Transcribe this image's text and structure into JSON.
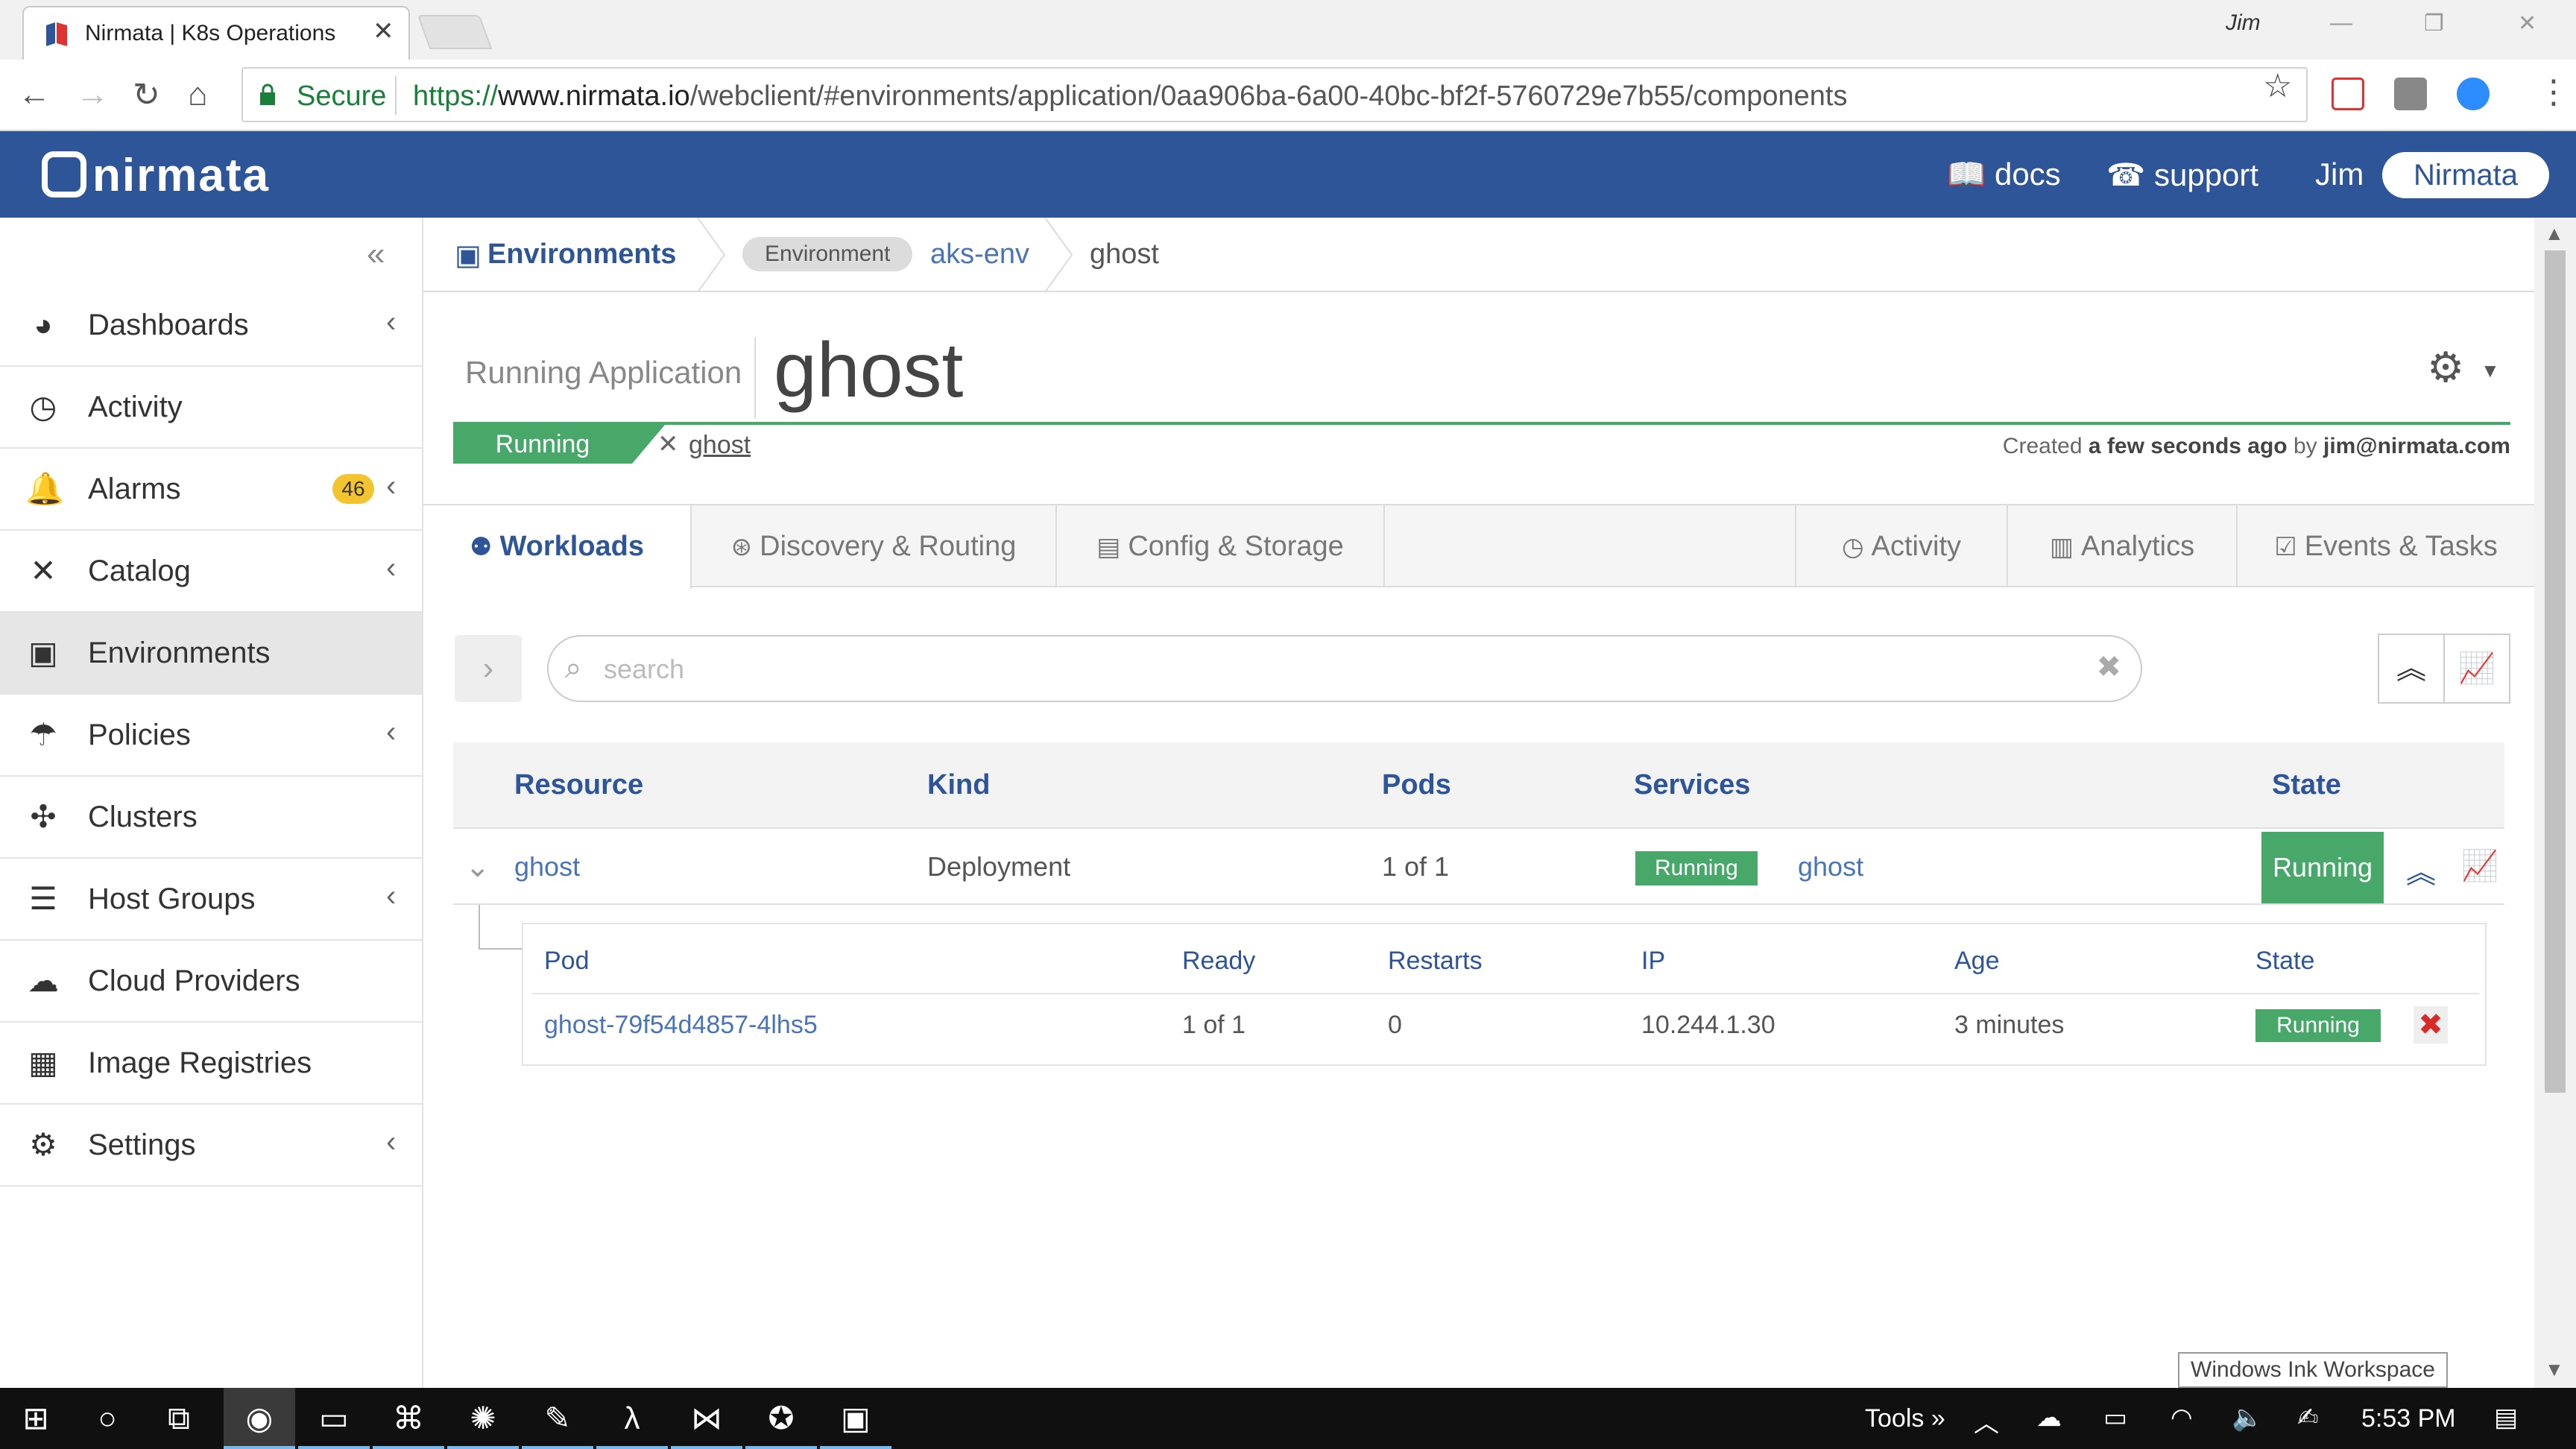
{
  "browser": {
    "tab_title": "Nirmata | K8s Operations",
    "profile_name": "Jim",
    "secure_label": "Secure",
    "url_protocol": "https://",
    "url_host": "www.nirmata.io",
    "url_path": "/webclient/#environments/application/0aa906ba-6a00-40bc-bf2f-5760729e7b55/components"
  },
  "header": {
    "logo": "nirmata",
    "docs_label": "docs",
    "support_label": "support",
    "user": "Jim",
    "org": "Nirmata",
    "brand_color": "#2d5597"
  },
  "sidebar": {
    "items": [
      {
        "label": "Dashboards",
        "icon": "dashboard-icon",
        "chevron": true
      },
      {
        "label": "Activity",
        "icon": "clock-icon",
        "chevron": false
      },
      {
        "label": "Alarms",
        "icon": "bell-icon",
        "chevron": true,
        "badge": "46"
      },
      {
        "label": "Catalog",
        "icon": "tools-icon",
        "chevron": true
      },
      {
        "label": "Environments",
        "icon": "monitor-icon",
        "chevron": false,
        "active": true
      },
      {
        "label": "Policies",
        "icon": "umbrella-icon",
        "chevron": true
      },
      {
        "label": "Clusters",
        "icon": "cluster-icon",
        "chevron": false
      },
      {
        "label": "Host Groups",
        "icon": "server-icon",
        "chevron": true
      },
      {
        "label": "Cloud Providers",
        "icon": "cloud-icon",
        "chevron": false
      },
      {
        "label": "Image Registries",
        "icon": "grid-icon",
        "chevron": false
      },
      {
        "label": "Settings",
        "icon": "gears-icon",
        "chevron": true
      }
    ]
  },
  "breadcrumb": {
    "root": "Environments",
    "type_pill": "Environment",
    "environment": "aks-env",
    "current": "ghost"
  },
  "app": {
    "subtitle": "Running Application",
    "title": "ghost",
    "status": "Running",
    "catalog_link": "ghost",
    "created_prefix": "Created",
    "created_when": "a few seconds ago",
    "created_by_prefix": "by",
    "created_by": "jim@nirmata.com"
  },
  "tabs": {
    "workloads": "Workloads",
    "discovery": "Discovery & Routing",
    "config": "Config & Storage",
    "activity": "Activity",
    "analytics": "Analytics",
    "events": "Events & Tasks"
  },
  "search": {
    "placeholder": "search",
    "value": ""
  },
  "workloads_table": {
    "headers": {
      "resource": "Resource",
      "kind": "Kind",
      "pods": "Pods",
      "services": "Services",
      "state": "State"
    },
    "rows": [
      {
        "resource": "ghost",
        "kind": "Deployment",
        "pods": "1 of 1",
        "service_status": "Running",
        "service_name": "ghost",
        "state": "Running"
      }
    ]
  },
  "pods_table": {
    "headers": {
      "pod": "Pod",
      "ready": "Ready",
      "restarts": "Restarts",
      "ip": "IP",
      "age": "Age",
      "state": "State"
    },
    "rows": [
      {
        "pod": "ghost-79f54d4857-4lhs5",
        "ready": "1 of 1",
        "restarts": "0",
        "ip": "10.244.1.30",
        "age": "3 minutes",
        "state": "Running"
      }
    ]
  },
  "tooltip": "Windows Ink Workspace",
  "taskbar": {
    "tools_label": "Tools",
    "time": "5:53 PM"
  },
  "colors": {
    "running_green": "#47a86a",
    "link_blue": "#4a75b5",
    "danger_red": "#d92a2a"
  }
}
